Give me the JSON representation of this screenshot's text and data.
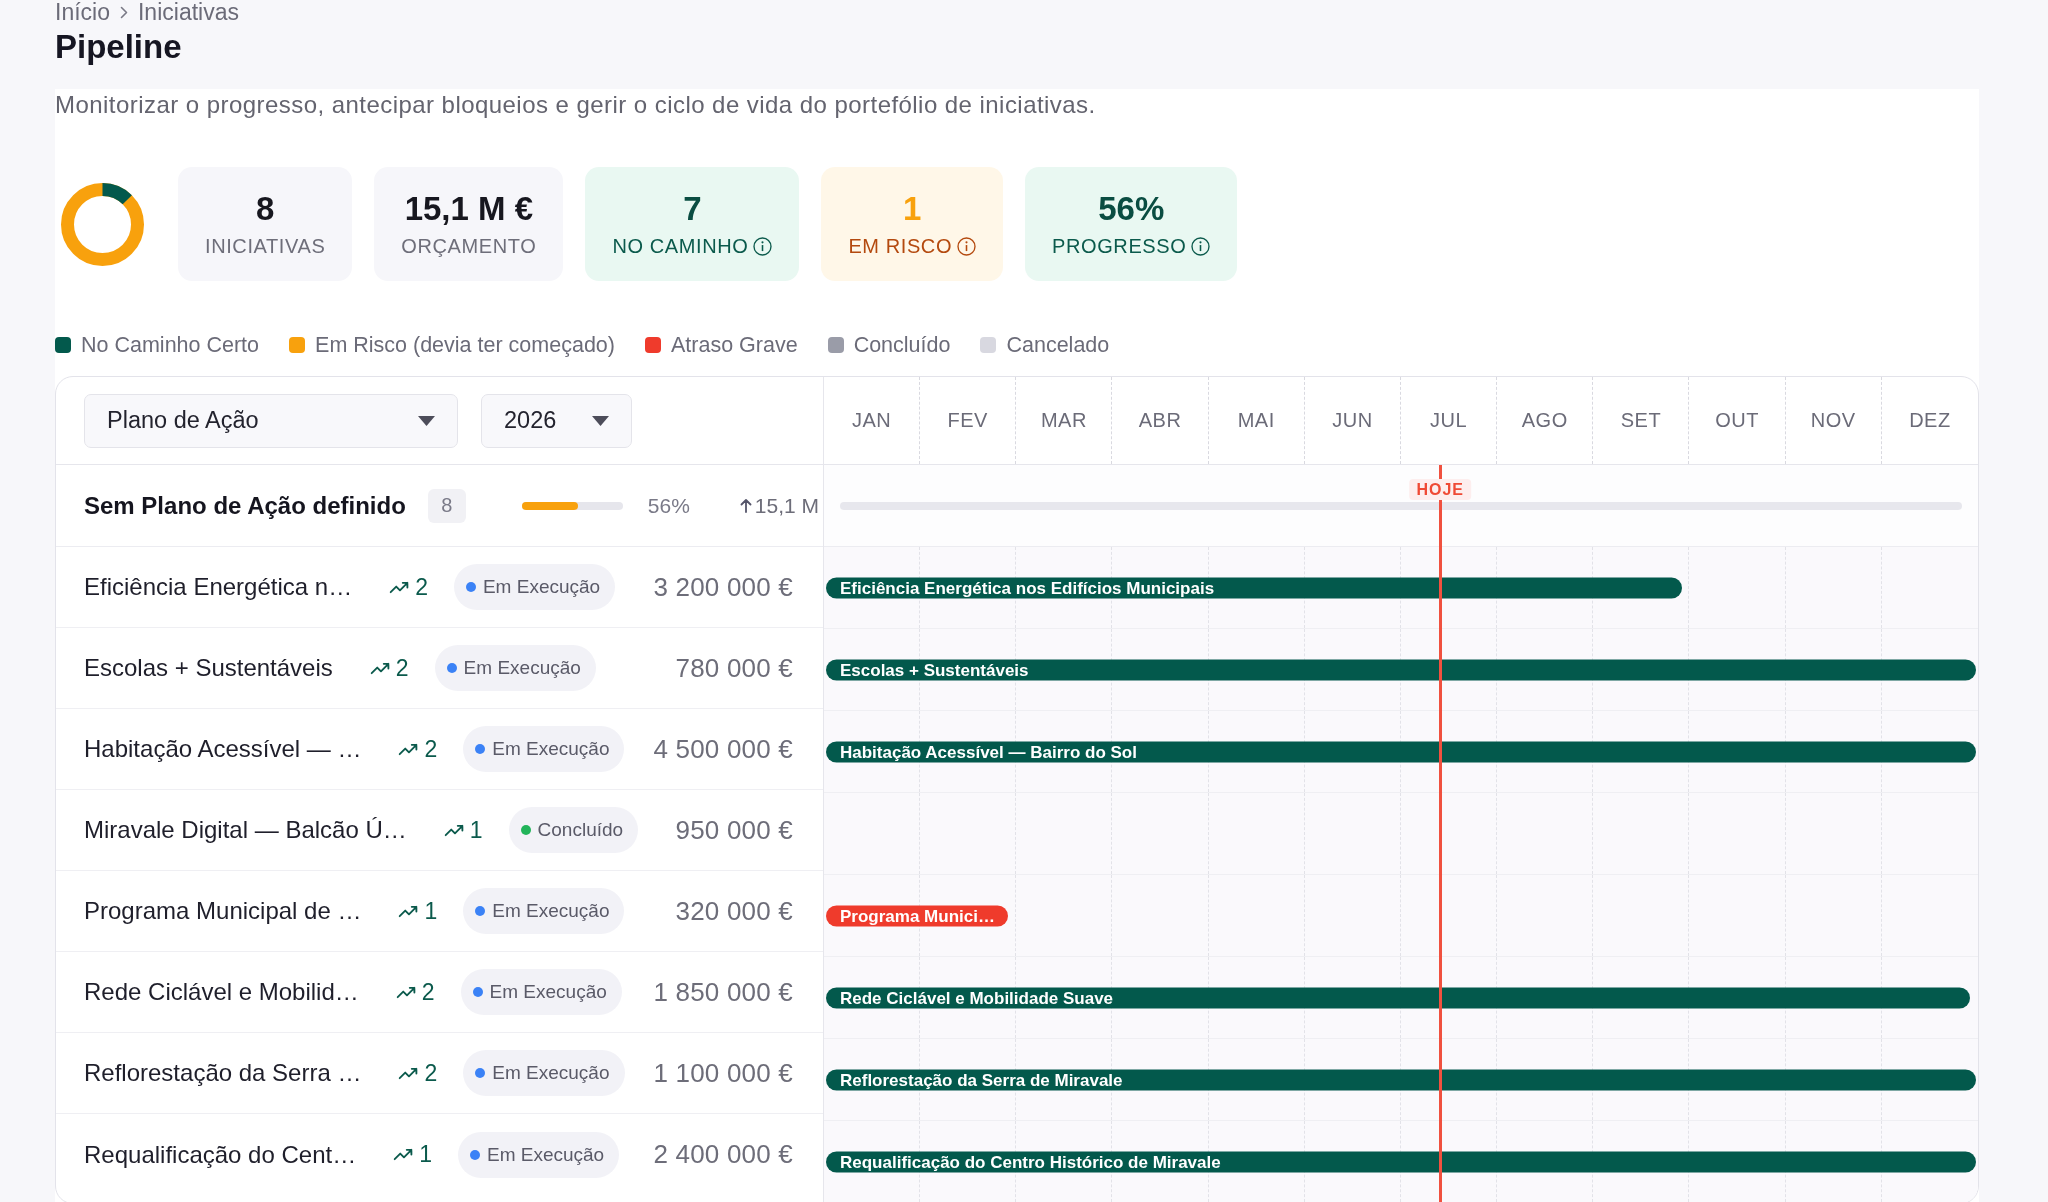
{
  "breadcrumb": [
    "Início",
    "Iniciativas"
  ],
  "title": "Pipeline",
  "subtitle": "Monitorizar o progresso, antecipar bloqueios e gerir o ciclo de vida do portefólio de iniciativas.",
  "kpis": [
    {
      "value": "8",
      "label": "INICIATIVAS",
      "kind": "neutral",
      "info": false
    },
    {
      "value": "15,1 M €",
      "label": "ORÇAMENTO",
      "kind": "neutral",
      "info": false
    },
    {
      "value": "7",
      "label": "NO CAMINHO",
      "kind": "success",
      "info": true
    },
    {
      "value": "1",
      "label": "EM RISCO",
      "kind": "warning",
      "info": true
    },
    {
      "value": "56%",
      "label": "PROGRESSO",
      "kind": "success",
      "info": true
    }
  ],
  "legend": [
    {
      "label": "No Caminho Certo",
      "color": "#03594c"
    },
    {
      "label": "Em Risco (devia ter começado)",
      "color": "#f8a10d"
    },
    {
      "label": "Atraso Grave",
      "color": "#ef3b2c"
    },
    {
      "label": "Concluído",
      "color": "#9a9ca8"
    },
    {
      "label": "Cancelado",
      "color": "#d8d8e0"
    }
  ],
  "filters": {
    "group_by": "Plano de Ação",
    "year": "2026"
  },
  "timeline": {
    "months": [
      "JAN",
      "FEV",
      "MAR",
      "ABR",
      "MAI",
      "JUN",
      "JUL",
      "AGO",
      "SET",
      "OUT",
      "NOV",
      "DEZ"
    ],
    "today": {
      "label": "HOJE",
      "level": 0.534
    }
  },
  "group": {
    "title": "Sem Plano de Ação definido",
    "count": "8",
    "progress": {
      "level": 0.56,
      "reading": "56%"
    },
    "budget": "15,1 M"
  },
  "rows": [
    {
      "name": "Eficiência Energética n…",
      "indicators": "2",
      "status": {
        "label": "Em Execução",
        "color": "#3b82f6"
      },
      "budget": "3 200 000 €",
      "bar": {
        "label": "Eficiência Energética nos Edifícios Municipais",
        "level": 0.744,
        "color": "#03594c"
      }
    },
    {
      "name": "Escolas + Sustentáveis",
      "indicators": "2",
      "status": {
        "label": "Em Execução",
        "color": "#3b82f6"
      },
      "budget": "780 000 €",
      "bar": {
        "label": "Escolas + Sustentáveis",
        "level": 1,
        "color": "#03594c"
      }
    },
    {
      "name": "Habitação Acessível — …",
      "indicators": "2",
      "status": {
        "label": "Em Execução",
        "color": "#3b82f6"
      },
      "budget": "4 500 000 €",
      "bar": {
        "label": "Habitação Acessível — Bairro do Sol",
        "level": 1,
        "color": "#03594c"
      }
    },
    {
      "name": "Miravale Digital — Balcão Ú…",
      "indicators": "1",
      "status": {
        "label": "Concluído",
        "color": "#22b45a"
      },
      "budget": "950 000 €"
    },
    {
      "name": "Programa Municipal de …",
      "indicators": "1",
      "status": {
        "label": "Em Execução",
        "color": "#3b82f6"
      },
      "budget": "320 000 €",
      "bar": {
        "label": "Programa Munici…",
        "level": 0.158,
        "color": "#ef3b2c"
      }
    },
    {
      "name": "Rede Ciclável e Mobilid…",
      "indicators": "2",
      "status": {
        "label": "Em Execução",
        "color": "#3b82f6"
      },
      "budget": "1 850 000 €",
      "bar": {
        "label": "Rede Ciclável e Mobilidade Suave",
        "level": 0.995,
        "color": "#03594c"
      }
    },
    {
      "name": "Reflorestação da Serra …",
      "indicators": "2",
      "status": {
        "label": "Em Execução",
        "color": "#3b82f6"
      },
      "budget": "1 100 000 €",
      "bar": {
        "label": "Reflorestação da Serra de Miravale",
        "level": 1,
        "color": "#03594c"
      }
    },
    {
      "name": "Requalificação do Cent…",
      "indicators": "1",
      "status": {
        "label": "Em Execução",
        "color": "#3b82f6"
      },
      "budget": "2 400 000 €",
      "bar": {
        "label": "Requalificação do Centro Histórico de Miravale",
        "level": 1,
        "color": "#03594c"
      }
    }
  ]
}
